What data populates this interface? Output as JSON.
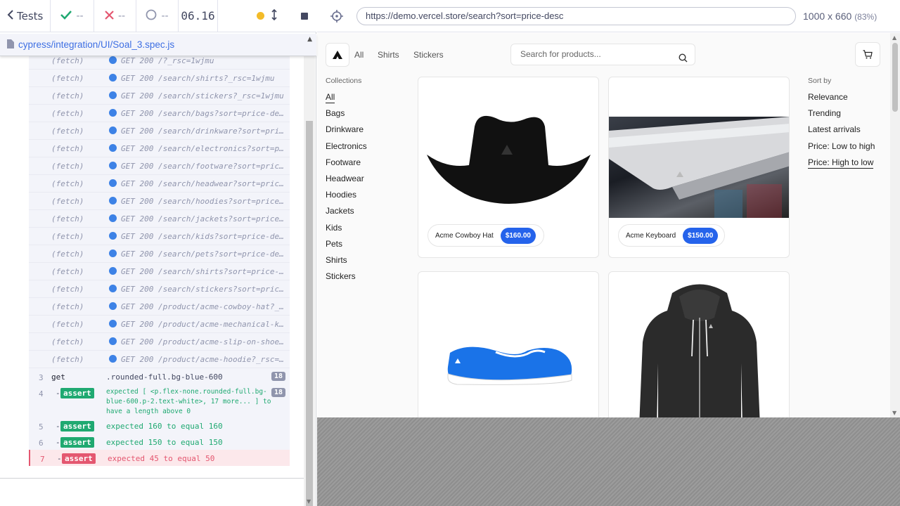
{
  "reporter": {
    "header": {
      "tests_label": "Tests",
      "passed": "--",
      "failed": "--",
      "pending": "--",
      "duration": "06.16"
    },
    "spec_path": "cypress/integration/UI/Soal_3.spec.js",
    "fetch_logs": [
      {
        "event": "(fetch)",
        "request": "GET 200 /?_rsc=1wjmu"
      },
      {
        "event": "(fetch)",
        "request": "GET 200 /search/shirts?_rsc=1wjmu"
      },
      {
        "event": "(fetch)",
        "request": "GET 200 /search/stickers?_rsc=1wjmu"
      },
      {
        "event": "(fetch)",
        "request": "GET 200 /search/bags?sort=price-de…"
      },
      {
        "event": "(fetch)",
        "request": "GET 200 /search/drinkware?sort=pri…"
      },
      {
        "event": "(fetch)",
        "request": "GET 200 /search/electronics?sort=p…"
      },
      {
        "event": "(fetch)",
        "request": "GET 200 /search/footware?sort=pric…"
      },
      {
        "event": "(fetch)",
        "request": "GET 200 /search/headwear?sort=pric…"
      },
      {
        "event": "(fetch)",
        "request": "GET 200 /search/hoodies?sort=price…"
      },
      {
        "event": "(fetch)",
        "request": "GET 200 /search/jackets?sort=price…"
      },
      {
        "event": "(fetch)",
        "request": "GET 200 /search/kids?sort=price-de…"
      },
      {
        "event": "(fetch)",
        "request": "GET 200 /search/pets?sort=price-de…"
      },
      {
        "event": "(fetch)",
        "request": "GET 200 /search/shirts?sort=price-…"
      },
      {
        "event": "(fetch)",
        "request": "GET 200 /search/stickers?sort=pric…"
      },
      {
        "event": "(fetch)",
        "request": "GET 200 /product/acme-cowboy-hat?_…"
      },
      {
        "event": "(fetch)",
        "request": "GET 200 /product/acme-mechanical-k…"
      },
      {
        "event": "(fetch)",
        "request": "GET 200 /product/acme-slip-on-shoe…"
      },
      {
        "event": "(fetch)",
        "request": "GET 200 /product/acme-hoodie?_rsc=…"
      }
    ],
    "commands": {
      "get": {
        "num": "3",
        "name": "get",
        "selector": ".rounded-full.bg-blue-600",
        "count": "18"
      },
      "assert4": {
        "num": "4",
        "dash": "-",
        "badge": "assert",
        "line1": "expected  [ <p.flex-none.rounded-full.bg-",
        "line2": "blue-600.p-2.text-white>, 17 more... ]  to",
        "line3": "have a length above  0",
        "count": "18"
      },
      "assert5": {
        "num": "5",
        "dash": "-",
        "badge": "assert",
        "text": "expected  160  to equal  160"
      },
      "assert6": {
        "num": "6",
        "dash": "-",
        "badge": "assert",
        "text": "expected  150  to equal  150"
      },
      "assert7": {
        "num": "7",
        "dash": "-",
        "badge": "assert",
        "text": "expected  45  to equal  50"
      }
    }
  },
  "aut": {
    "url": "https://demo.vercel.store/search?sort=price-desc",
    "viewport": "1000 x 660",
    "scale": "(83%)"
  },
  "store": {
    "nav": [
      "All",
      "Shirts",
      "Stickers"
    ],
    "search_placeholder": "Search for products...",
    "collections_title": "Collections",
    "collections": [
      "All",
      "Bags",
      "Drinkware",
      "Electronics",
      "Footware",
      "Headwear",
      "Hoodies",
      "Jackets",
      "Kids",
      "Pets",
      "Shirts",
      "Stickers"
    ],
    "sort_title": "Sort by",
    "sort_options": [
      "Relevance",
      "Trending",
      "Latest arrivals",
      "Price: Low to high",
      "Price: High to low"
    ],
    "products": [
      {
        "name": "Acme Cowboy Hat",
        "price": "$160.00"
      },
      {
        "name": "Acme Keyboard",
        "price": "$150.00"
      }
    ]
  },
  "colors": {
    "pass": "#1fa971",
    "fail": "#e45770",
    "link": "#3e6fe3",
    "price_pill": "#2563eb"
  }
}
